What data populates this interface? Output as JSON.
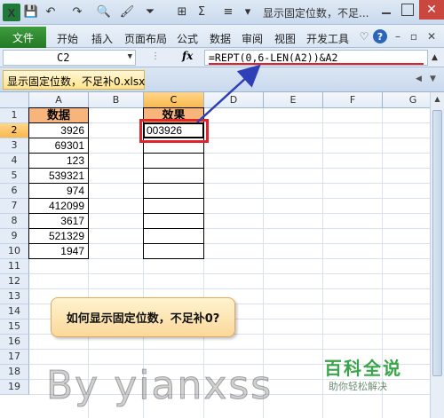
{
  "window": {
    "title": "显示固定位数，不足...",
    "close_glyph": "✕"
  },
  "quick_access": {
    "excel_glyph": "X",
    "icons": [
      "save-icon",
      "undo-icon",
      "redo-icon",
      "print-preview-icon",
      "format-painter-icon",
      "filter-icon",
      "borders-icon",
      "autosum-icon",
      "align-icon",
      "customize-icon"
    ]
  },
  "ribbon": {
    "file_label": "文件",
    "tabs": [
      "开始",
      "插入",
      "页面布局",
      "公式",
      "数据",
      "审阅",
      "视图",
      "开发工具"
    ],
    "help_glyph": "?"
  },
  "formula_bar": {
    "name_box": "C2",
    "fx_label": "fx",
    "formula": "=REPT(0,6-LEN(A2))&A2"
  },
  "workbook": {
    "tab_label": "显示固定位数，不足补0.xlsx"
  },
  "grid": {
    "columns": [
      "A",
      "B",
      "C",
      "D",
      "E",
      "F",
      "G"
    ],
    "selected_column": "C",
    "rows": [
      "1",
      "2",
      "3",
      "4",
      "5",
      "6",
      "7",
      "8",
      "9",
      "10",
      "11",
      "12",
      "13",
      "14",
      "15",
      "16",
      "17",
      "18",
      "19"
    ],
    "selected_row": "2",
    "header_a": "数据",
    "header_c": "效果",
    "values_a": [
      "3926",
      "69301",
      "123",
      "539321",
      "974",
      "412099",
      "3617",
      "521329",
      "1947"
    ],
    "values_c": [
      "003926",
      "",
      "",
      "",
      "",
      "",
      "",
      "",
      ""
    ]
  },
  "callout": {
    "text": "如何显示固定位数，不足补0?"
  },
  "watermark": {
    "brand": "百科全说",
    "tagline": "助你轻松解决",
    "author": "By yianxss"
  },
  "colors": {
    "header_fill": "#f7b57c",
    "highlight": "#e0242a",
    "arrow": "#2f3fb8",
    "file_tab": "#237a23"
  }
}
